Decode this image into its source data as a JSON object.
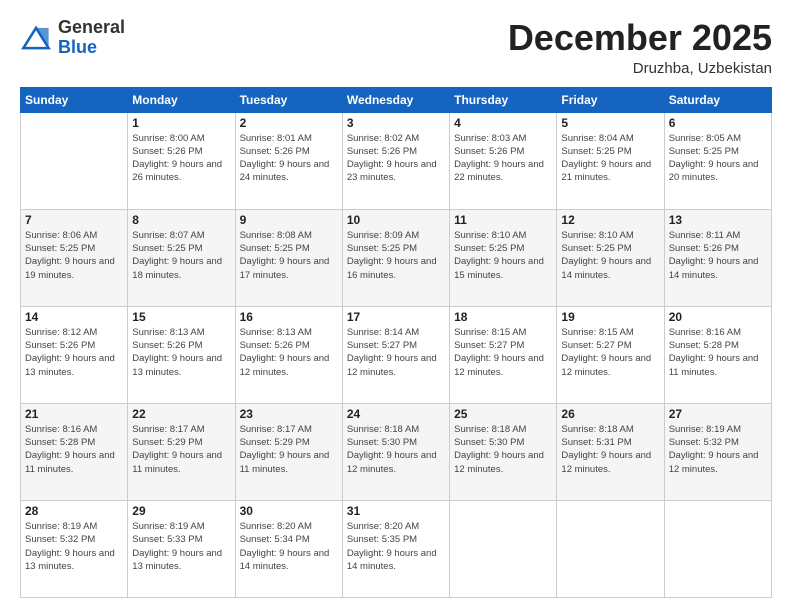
{
  "logo": {
    "general": "General",
    "blue": "Blue"
  },
  "header": {
    "month": "December 2025",
    "location": "Druzhba, Uzbekistan"
  },
  "days_of_week": [
    "Sunday",
    "Monday",
    "Tuesday",
    "Wednesday",
    "Thursday",
    "Friday",
    "Saturday"
  ],
  "weeks": [
    [
      {
        "day": "",
        "info": ""
      },
      {
        "day": "1",
        "info": "Sunrise: 8:00 AM\nSunset: 5:26 PM\nDaylight: 9 hours\nand 26 minutes."
      },
      {
        "day": "2",
        "info": "Sunrise: 8:01 AM\nSunset: 5:26 PM\nDaylight: 9 hours\nand 24 minutes."
      },
      {
        "day": "3",
        "info": "Sunrise: 8:02 AM\nSunset: 5:26 PM\nDaylight: 9 hours\nand 23 minutes."
      },
      {
        "day": "4",
        "info": "Sunrise: 8:03 AM\nSunset: 5:26 PM\nDaylight: 9 hours\nand 22 minutes."
      },
      {
        "day": "5",
        "info": "Sunrise: 8:04 AM\nSunset: 5:25 PM\nDaylight: 9 hours\nand 21 minutes."
      },
      {
        "day": "6",
        "info": "Sunrise: 8:05 AM\nSunset: 5:25 PM\nDaylight: 9 hours\nand 20 minutes."
      }
    ],
    [
      {
        "day": "7",
        "info": "Sunrise: 8:06 AM\nSunset: 5:25 PM\nDaylight: 9 hours\nand 19 minutes."
      },
      {
        "day": "8",
        "info": "Sunrise: 8:07 AM\nSunset: 5:25 PM\nDaylight: 9 hours\nand 18 minutes."
      },
      {
        "day": "9",
        "info": "Sunrise: 8:08 AM\nSunset: 5:25 PM\nDaylight: 9 hours\nand 17 minutes."
      },
      {
        "day": "10",
        "info": "Sunrise: 8:09 AM\nSunset: 5:25 PM\nDaylight: 9 hours\nand 16 minutes."
      },
      {
        "day": "11",
        "info": "Sunrise: 8:10 AM\nSunset: 5:25 PM\nDaylight: 9 hours\nand 15 minutes."
      },
      {
        "day": "12",
        "info": "Sunrise: 8:10 AM\nSunset: 5:25 PM\nDaylight: 9 hours\nand 14 minutes."
      },
      {
        "day": "13",
        "info": "Sunrise: 8:11 AM\nSunset: 5:26 PM\nDaylight: 9 hours\nand 14 minutes."
      }
    ],
    [
      {
        "day": "14",
        "info": "Sunrise: 8:12 AM\nSunset: 5:26 PM\nDaylight: 9 hours\nand 13 minutes."
      },
      {
        "day": "15",
        "info": "Sunrise: 8:13 AM\nSunset: 5:26 PM\nDaylight: 9 hours\nand 13 minutes."
      },
      {
        "day": "16",
        "info": "Sunrise: 8:13 AM\nSunset: 5:26 PM\nDaylight: 9 hours\nand 12 minutes."
      },
      {
        "day": "17",
        "info": "Sunrise: 8:14 AM\nSunset: 5:27 PM\nDaylight: 9 hours\nand 12 minutes."
      },
      {
        "day": "18",
        "info": "Sunrise: 8:15 AM\nSunset: 5:27 PM\nDaylight: 9 hours\nand 12 minutes."
      },
      {
        "day": "19",
        "info": "Sunrise: 8:15 AM\nSunset: 5:27 PM\nDaylight: 9 hours\nand 12 minutes."
      },
      {
        "day": "20",
        "info": "Sunrise: 8:16 AM\nSunset: 5:28 PM\nDaylight: 9 hours\nand 11 minutes."
      }
    ],
    [
      {
        "day": "21",
        "info": "Sunrise: 8:16 AM\nSunset: 5:28 PM\nDaylight: 9 hours\nand 11 minutes."
      },
      {
        "day": "22",
        "info": "Sunrise: 8:17 AM\nSunset: 5:29 PM\nDaylight: 9 hours\nand 11 minutes."
      },
      {
        "day": "23",
        "info": "Sunrise: 8:17 AM\nSunset: 5:29 PM\nDaylight: 9 hours\nand 11 minutes."
      },
      {
        "day": "24",
        "info": "Sunrise: 8:18 AM\nSunset: 5:30 PM\nDaylight: 9 hours\nand 12 minutes."
      },
      {
        "day": "25",
        "info": "Sunrise: 8:18 AM\nSunset: 5:30 PM\nDaylight: 9 hours\nand 12 minutes."
      },
      {
        "day": "26",
        "info": "Sunrise: 8:18 AM\nSunset: 5:31 PM\nDaylight: 9 hours\nand 12 minutes."
      },
      {
        "day": "27",
        "info": "Sunrise: 8:19 AM\nSunset: 5:32 PM\nDaylight: 9 hours\nand 12 minutes."
      }
    ],
    [
      {
        "day": "28",
        "info": "Sunrise: 8:19 AM\nSunset: 5:32 PM\nDaylight: 9 hours\nand 13 minutes."
      },
      {
        "day": "29",
        "info": "Sunrise: 8:19 AM\nSunset: 5:33 PM\nDaylight: 9 hours\nand 13 minutes."
      },
      {
        "day": "30",
        "info": "Sunrise: 8:20 AM\nSunset: 5:34 PM\nDaylight: 9 hours\nand 14 minutes."
      },
      {
        "day": "31",
        "info": "Sunrise: 8:20 AM\nSunset: 5:35 PM\nDaylight: 9 hours\nand 14 minutes."
      },
      {
        "day": "",
        "info": ""
      },
      {
        "day": "",
        "info": ""
      },
      {
        "day": "",
        "info": ""
      }
    ]
  ]
}
